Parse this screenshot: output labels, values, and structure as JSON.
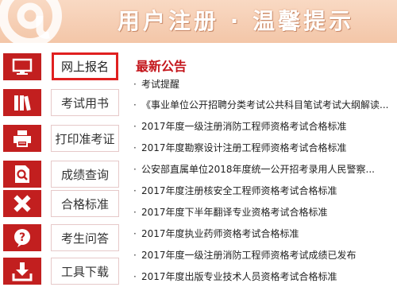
{
  "banner": {
    "title": "用户注册 · 温馨提示"
  },
  "sidebar": {
    "items": [
      {
        "label": "网上报名",
        "icon": "monitor-icon",
        "active": true
      },
      {
        "label": "考试用书",
        "icon": "books-icon",
        "active": false
      },
      {
        "label": "打印准考证",
        "icon": "printer-icon",
        "active": false
      },
      {
        "label": "成绩查询",
        "icon": "document-search-icon",
        "active": false
      },
      {
        "label": "合格标准",
        "icon": "pencil-ruler-icon",
        "active": false
      },
      {
        "label": "考生问答",
        "icon": "question-icon",
        "active": false
      },
      {
        "label": "工具下载",
        "icon": "download-icon",
        "active": false
      }
    ]
  },
  "notices": {
    "title": "最新公告",
    "items": [
      "考试提醒",
      "《事业单位公开招聘分类考试公共科目笔试考试大纲解读...",
      "2017年度一级注册消防工程师资格考试合格标准",
      "2017年度勘察设计注册工程师资格考试合格标准",
      "公安部直属单位2018年度统一公开招考录用人民警察...",
      "2017年度注册核安全工程师资格考试合格标准",
      "2017年度下半年翻译专业资格考试合格标准",
      "2017年度执业药师资格考试合格标准",
      "2017年度一级注册消防工程师资格考试成绩已发布",
      "2017年度出版专业技术人员资格考试合格标准"
    ]
  },
  "colors": {
    "brand_red": "#c21f1f",
    "banner_peach": "#f3c6a8",
    "active_border": "#e02020"
  }
}
